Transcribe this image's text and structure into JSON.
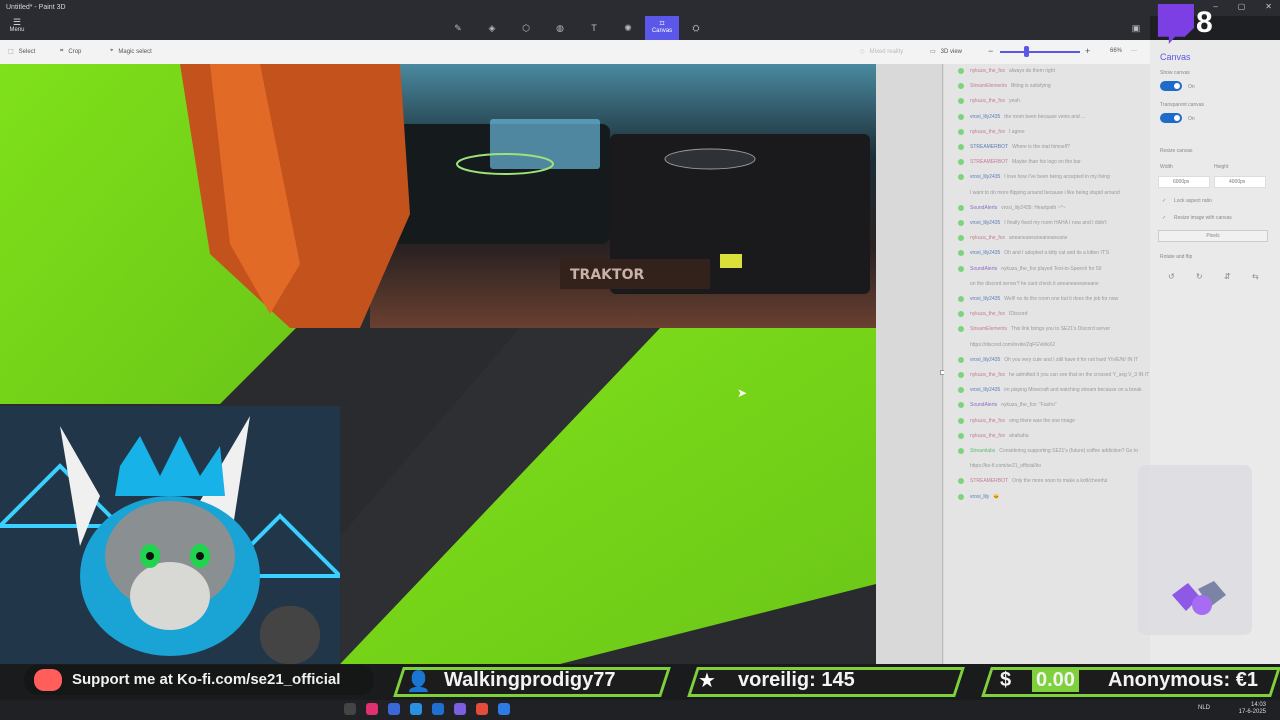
{
  "window": {
    "title": "Untitled* - Paint 3D",
    "controls": [
      "–",
      "▢",
      "✕"
    ]
  },
  "toolbar": {
    "menu_label": "Menu",
    "tools": [
      "brushes-icon",
      "2d-shapes-icon",
      "3d-shapes-icon",
      "stickers-icon",
      "text-icon",
      "effects-icon",
      "canvas-icon",
      "3d-library-icon"
    ],
    "active_tool_label": "Canvas",
    "top_right_glyph": "⤺"
  },
  "subbar": {
    "select_label": "Select",
    "crop_label": "Crop",
    "magic_select_label": "Magic select",
    "mixed_reality_label": "Mixed reality",
    "view_3d_label": "3D view",
    "zoom_percent": "66%",
    "minus": "−",
    "plus": "+",
    "more": "···"
  },
  "panel": {
    "title": "Canvas",
    "show_canvas": {
      "label": "Show canvas",
      "state": "On"
    },
    "transparent_canvas": {
      "label": "Transparent canvas",
      "state": "On"
    },
    "resize_label": "Resize canvas",
    "width_label": "Width",
    "height_label": "Height",
    "width_value": "6000px",
    "height_value": "4000px",
    "lock_aspect": "Lock aspect ratio",
    "resize_image": "Resize image with canvas",
    "units": "Pixels",
    "rotate_flip": "Rotate and flip"
  },
  "chat": [
    {
      "user": "nykuza_the_fox",
      "color": "pink",
      "text": "always do them right"
    },
    {
      "user": "StreamElements",
      "color": "pink",
      "text": "Biting is satisfying"
    },
    {
      "user": "nykuza_the_fox",
      "color": "pink",
      "text": "yeah"
    },
    {
      "user": "vroxi_lily2435",
      "color": "blue",
      "text": "the room been because veins and ..."
    },
    {
      "user": "nykuza_the_fox",
      "color": "pink",
      "text": "I agree"
    },
    {
      "user": "STREAMERBOT",
      "color": "blue",
      "text": "Where is the mat himself?"
    },
    {
      "user": "STREAMERBOT",
      "color": "pink",
      "text": "Maybe than his logo on the bar"
    },
    {
      "user": "vroxi_lily2435",
      "color": "blue",
      "text": "I love how I've been being accepted in my living"
    },
    {
      "user": "",
      "color": "blue",
      "text": "I want to do more flipping around because i like being stupid around"
    },
    {
      "user": "SoundAlerts",
      "color": "purple",
      "text": "vroxi_lily2435: Heartpath ~*~"
    },
    {
      "user": "vroxi_lily2435",
      "color": "blue",
      "text": "I finally fixed my room HAHA I now and I didn't"
    },
    {
      "user": "nykuza_the_fox",
      "color": "pink",
      "text": "aneaneaneaneaneaneane"
    },
    {
      "user": "vroxi_lily2435",
      "color": "blue",
      "text": "Oh and I adopted a kitty cat and its a kitten IT'S"
    },
    {
      "user": "SoundAlerts",
      "color": "purple",
      "text": "nykuza_the_fox played Text-to-Speech for 50"
    },
    {
      "user": "",
      "color": "blue",
      "text": "on the discord server? he cant check it aneaneaneaneane"
    },
    {
      "user": "vroxi_lily2435",
      "color": "blue",
      "text": "Well! no its the room one but it does the job for now"
    },
    {
      "user": "nykuza_the_fox",
      "color": "pink",
      "text": "IDiscord"
    },
    {
      "user": "StreamElements",
      "color": "pink",
      "text": "This link brings you to SE21's Discord server"
    },
    {
      "user": "",
      "color": "blue",
      "text": "https://discord.com/invite/ZqFGVetkX2"
    },
    {
      "user": "vroxi_lily2435",
      "color": "blue",
      "text": "Oh you very cute and I still have it for not hard Y/v/E/N/ IN IT"
    },
    {
      "user": "nykuza_the_fox",
      "color": "pink",
      "text": "he admitted it you can see that on the crossed Y_seg V_3 IN IT"
    },
    {
      "user": "vroxi_lily2435",
      "color": "blue",
      "text": "im playing Minecraft and watching stream because on a break"
    },
    {
      "user": "SoundAlerts",
      "color": "purple",
      "text": "nykuza_the_fox: \"Fasho\""
    },
    {
      "user": "nykuza_the_fox",
      "color": "pink",
      "text": "omg there was the one image"
    },
    {
      "user": "nykuza_the_fox",
      "color": "pink",
      "text": "ahahaha"
    },
    {
      "user": "Streamlabs",
      "color": "green",
      "text": "Considering supporting SE21's (future) coffee addiction? Go to"
    },
    {
      "user": "",
      "color": "blue",
      "text": "https://ko-fi.com/se21_official/ko"
    },
    {
      "user": "STREAMERBOT",
      "color": "pink",
      "text": "Only the more soon to make a kofi/cheerful"
    },
    {
      "user": "vroxi_lily",
      "color": "blue",
      "text": "🐱‍"
    }
  ],
  "twitch": {
    "viewers": "8"
  },
  "overlay": {
    "kofi": "Support me at Ko-fi.com/se21_official",
    "follower": "Walkingprodigy77",
    "sub": "voreilig: 145",
    "donation_amount": "0.00",
    "donation_currency_symbol": "$",
    "donor": "Anonymous: €1"
  },
  "taskbar": {
    "lang": "NLD",
    "time": "14:03",
    "date": "17-6-2025"
  },
  "colors": {
    "green_screen": "#7fe11a",
    "accent": "#5b57e8",
    "twitch": "#7b3fe4",
    "overlay_green": "#7fd13b"
  }
}
